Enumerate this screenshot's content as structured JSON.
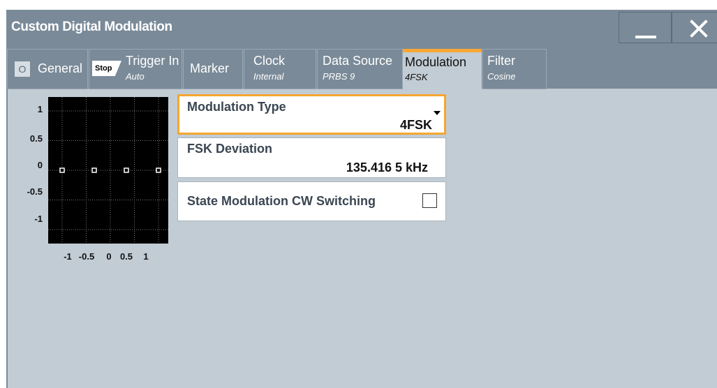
{
  "window": {
    "title": "Custom Digital Modulation",
    "minimize_icon": "minimize-icon",
    "close_icon": "close-icon"
  },
  "tabs": [
    {
      "id": "general",
      "name": "General",
      "state_indicator": "O"
    },
    {
      "id": "trigger",
      "name": "Trigger In",
      "value": "Auto",
      "badge": "Stop"
    },
    {
      "id": "marker",
      "name": "Marker"
    },
    {
      "id": "clock",
      "name": "Clock",
      "value": "Internal"
    },
    {
      "id": "datasource",
      "name": "Data Source",
      "value": "PRBS 9"
    },
    {
      "id": "modulation",
      "name": "Modulation",
      "value": "4FSK",
      "active": true
    },
    {
      "id": "filter",
      "name": "Filter",
      "value": "Cosine"
    }
  ],
  "constellation": {
    "y_ticks": [
      "1",
      "0.5",
      "0",
      "-0.5",
      "-1"
    ],
    "x_ticks": [
      "-1",
      "-0.5",
      "0",
      "0.5",
      "1"
    ],
    "points": [
      [
        -1,
        0
      ],
      [
        -0.333,
        0
      ],
      [
        0.333,
        0
      ],
      [
        1,
        0
      ]
    ]
  },
  "fields": {
    "modulation_type": {
      "label": "Modulation Type",
      "value": "4FSK"
    },
    "fsk_deviation": {
      "label": "FSK Deviation",
      "value": "135.416 5 kHz"
    },
    "state_cw_switching": {
      "label": "State Modulation CW Switching",
      "checked": false
    }
  },
  "colors": {
    "title_bar": "#7a8a98",
    "panel": "#c2ccd4",
    "accent": "#f7a733"
  }
}
